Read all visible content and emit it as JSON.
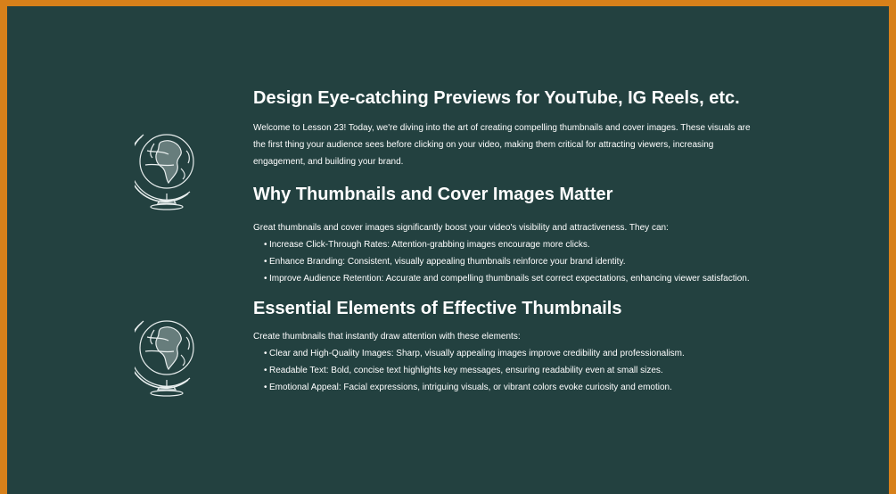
{
  "colors": {
    "background": "#234140",
    "border": "#d7801a",
    "text": "#ffffff"
  },
  "icons": [
    "globe-icon",
    "globe-icon"
  ],
  "section1": {
    "title": "Design Eye-catching Previews for YouTube, IG Reels, etc.",
    "paragraph_lines": [
      "Welcome to Lesson 23! Today, we're diving into the art of creating compelling thumbnails and cover images. These visuals are",
      "the first thing your audience sees before clicking on your video, making them critical for attracting viewers, increasing",
      "engagement, and building your brand."
    ]
  },
  "section2": {
    "title": "Why Thumbnails and Cover Images Matter",
    "intro": "Great thumbnails and cover images significantly boost your video's visibility and attractiveness. They can:",
    "bullets": [
      "Increase Click-Through Rates: Attention-grabbing images encourage more clicks.",
      "Enhance Branding: Consistent, visually appealing thumbnails reinforce your brand identity.",
      "Improve Audience Retention: Accurate and compelling thumbnails set correct expectations, enhancing viewer satisfaction."
    ]
  },
  "section3": {
    "title": "Essential Elements of Effective Thumbnails",
    "intro": "Create thumbnails that instantly draw attention with these elements:",
    "bullets": [
      "Clear and High-Quality Images: Sharp, visually appealing images improve credibility and professionalism.",
      "Readable Text: Bold, concise text highlights key messages, ensuring readability even at small sizes.",
      "Emotional Appeal: Facial expressions, intriguing visuals, or vibrant colors evoke curiosity and emotion."
    ]
  },
  "bullet_marker": "•"
}
